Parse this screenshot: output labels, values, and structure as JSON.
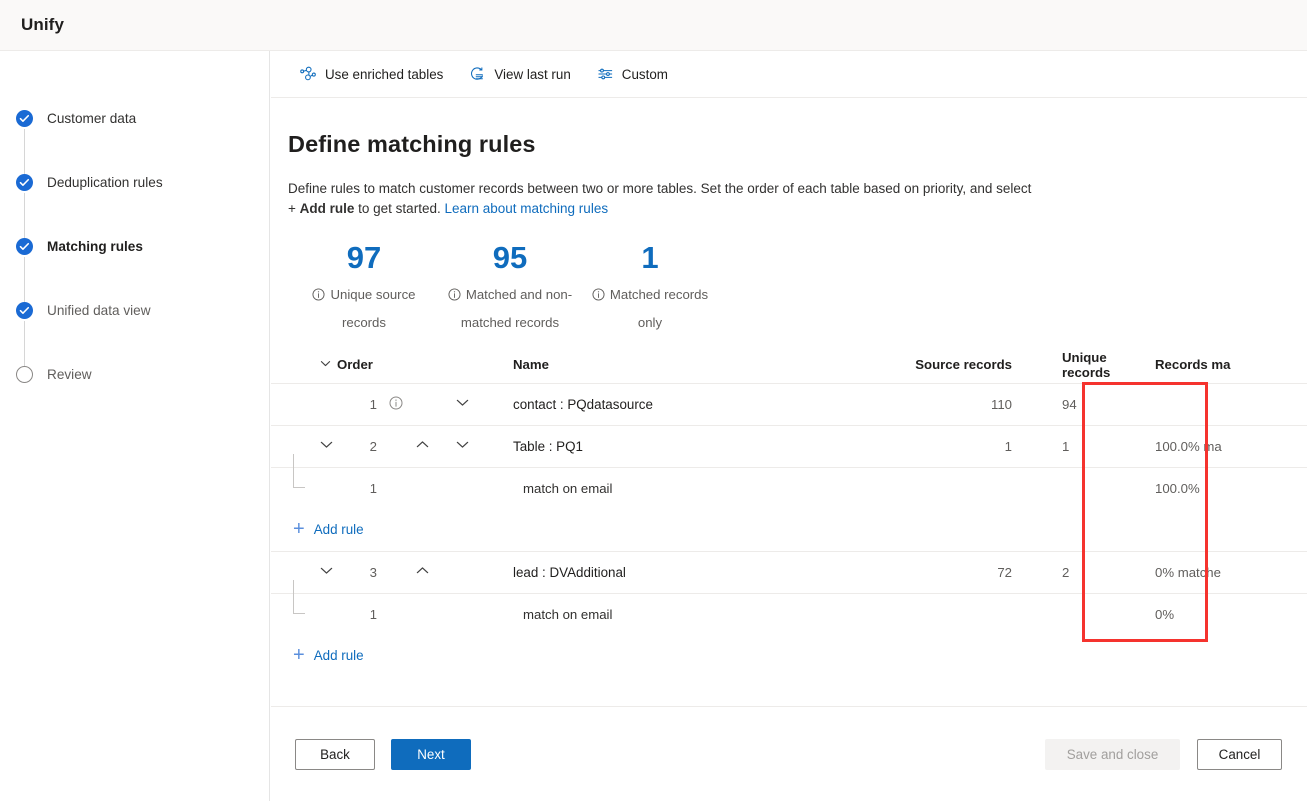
{
  "app": {
    "title": "Unify"
  },
  "sidebar": {
    "items": [
      {
        "label": "Customer data",
        "state": "done",
        "icon": "check-circle-icon"
      },
      {
        "label": "Deduplication rules",
        "state": "done",
        "icon": "check-circle-icon"
      },
      {
        "label": "Matching rules",
        "state": "current",
        "icon": "check-circle-icon"
      },
      {
        "label": "Unified data view",
        "state": "done",
        "icon": "check-circle-icon"
      },
      {
        "label": "Review",
        "state": "todo",
        "icon": "empty-circle-icon"
      }
    ]
  },
  "commandbar": {
    "items": [
      {
        "label": "Use enriched tables",
        "icon": "enrich-nodes-icon"
      },
      {
        "label": "View last run",
        "icon": "history-clock-icon"
      },
      {
        "label": "Custom",
        "icon": "sliders-icon"
      }
    ]
  },
  "page": {
    "title": "Define matching rules",
    "description_part1": "Define rules to match customer records between two or more tables. Set the order of each table based on priority, and select + ",
    "description_bold": "Add rule",
    "description_part2": " to get started. ",
    "link": "Learn about matching rules"
  },
  "kpis": [
    {
      "value": "97",
      "caption": "Unique source records",
      "icon": "info-icon"
    },
    {
      "value": "95",
      "caption": "Matched and non-matched records",
      "icon": "info-icon"
    },
    {
      "value": "1",
      "caption": "Matched records only",
      "icon": "info-icon"
    }
  ],
  "table": {
    "headers": {
      "order": "Order",
      "name": "Name",
      "source_records": "Source records",
      "unique_records": "Unique records",
      "records_matched": "Records ma"
    },
    "rows": [
      {
        "type": "main",
        "order": "1",
        "name": "contact : PQdatasource",
        "source_records": "110",
        "unique_records": "94",
        "records_matched": "",
        "has_info": true,
        "has_expand": false,
        "has_up": false,
        "has_down": true
      },
      {
        "type": "main",
        "order": "2",
        "name": "Table : PQ1",
        "source_records": "1",
        "unique_records": "1",
        "records_matched": "100.0% ma",
        "has_info": false,
        "has_expand": true,
        "has_up": true,
        "has_down": true
      },
      {
        "type": "sub",
        "index": "1",
        "name": "match on email",
        "source_records": "",
        "unique_records": "",
        "records_matched": "100.0%"
      },
      {
        "type": "addrule",
        "label": "Add rule"
      },
      {
        "type": "main",
        "order": "3",
        "name": "lead : DVAdditional",
        "source_records": "72",
        "unique_records": "2",
        "records_matched": "0% matche",
        "has_info": false,
        "has_expand": true,
        "has_up": true,
        "has_down": false
      },
      {
        "type": "sub",
        "index": "1",
        "name": "match on email",
        "source_records": "",
        "unique_records": "",
        "records_matched": "0%"
      },
      {
        "type": "addrule",
        "label": "Add rule"
      }
    ]
  },
  "scrollbar": {
    "left_arrow": "scroll-left-arrow-icon",
    "right_arrow": "scroll-right-arrow-icon"
  },
  "annotation": {
    "color": "#f5332e",
    "target": "unique-records-column"
  },
  "footer": {
    "back": "Back",
    "next": "Next",
    "save_and_close": "Save and close",
    "cancel": "Cancel"
  },
  "colors": {
    "accent": "#0f6cbd",
    "step_done": "#1a6ad4",
    "annotation_red": "#f5332e",
    "appbar_bg": "#faf9f8"
  }
}
